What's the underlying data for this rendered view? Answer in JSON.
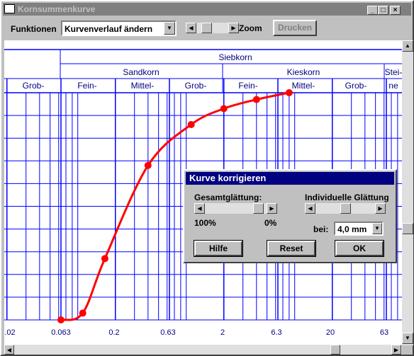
{
  "window": {
    "title": "Kornsummenkurve",
    "min_icon": "minimize-icon",
    "max_icon": "maximize-icon",
    "close_icon": "close-icon"
  },
  "toolbar": {
    "funktionen_label": "Funktionen",
    "combo_value": "Kurvenverlauf ändern",
    "zoom_label": "Zoom",
    "drucken_label": "Drucken"
  },
  "chart": {
    "siebkorn": "Siebkorn",
    "sandkorn": "Sandkorn",
    "kieskorn": "Kieskorn",
    "steine": "Stei-",
    "steine2": "ne",
    "sub": [
      "Grob-",
      "Fein-",
      "Mittel-",
      "Grob-",
      "Fein-",
      "Mittel-",
      "Grob-"
    ],
    "xticks": [
      ".02",
      "0.063",
      "0.2",
      "0.63",
      "2",
      "6.3",
      "20",
      "63"
    ],
    "curve_color": "#ff0000",
    "grid_color": "#0000ff"
  },
  "chart_data": {
    "type": "line",
    "xscale": "log",
    "xlabel": "",
    "ylabel": "",
    "x": [
      0.063,
      0.1,
      0.16,
      0.4,
      1.0,
      2.0,
      4.0,
      8.0
    ],
    "y": [
      0,
      3,
      27,
      68,
      86,
      93,
      97,
      100
    ]
  },
  "dialog": {
    "title": "Kurve korrigieren",
    "gesamt_label": "Gesamtglättung:",
    "indiv_label": "Individuelle Glättung",
    "pct100": "100%",
    "pct0": "0%",
    "bei_label": "bei:",
    "bei_value": "4,0 mm",
    "gesamt_level": 0.95,
    "indiv_level": 0.5,
    "hilfe": "Hilfe",
    "reset": "Reset",
    "ok": "OK"
  }
}
